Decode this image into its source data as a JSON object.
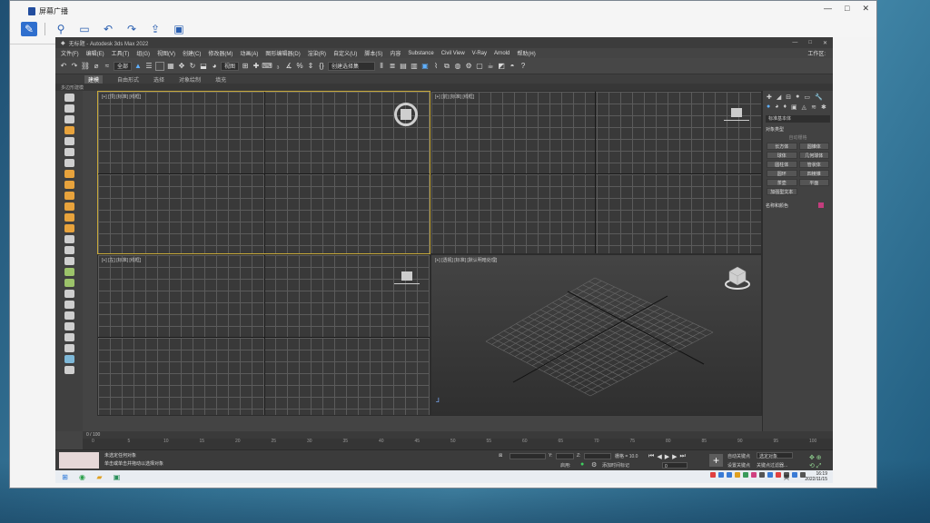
{
  "recorder": {
    "title": "屏幕广播",
    "window_controls": [
      "—",
      "□",
      "✕"
    ],
    "tools": [
      {
        "icon": "pen-icon",
        "selected": true
      },
      {
        "icon": "zoom-icon"
      },
      {
        "icon": "screen-icon"
      },
      {
        "icon": "undo-icon"
      },
      {
        "icon": "redo-icon"
      },
      {
        "icon": "upload-icon"
      },
      {
        "icon": "device-icon"
      }
    ]
  },
  "app": {
    "title": "无标题 - Autodesk 3ds Max 2022",
    "workspace_label": "工作区:",
    "menu": [
      "文件(F)",
      "编辑(E)",
      "工具(T)",
      "组(G)",
      "视图(V)",
      "创建(C)",
      "修改器(M)",
      "动画(A)",
      "图形编辑器(D)",
      "渲染(R)",
      "自定义(U)",
      "脚本(S)",
      "内容",
      "Substance",
      "Civil View",
      "V-Ray",
      "Arnold",
      "帮助(H)"
    ],
    "select_filter": "全部",
    "view_dropdown": "视图",
    "named_selection": "创建选择集",
    "ribbon_tabs": [
      "建模",
      "自由形式",
      "选择",
      "对象绘制",
      "填充"
    ],
    "active_ribbon": "建模",
    "sub_ribbon": "多边形建模",
    "viewports": {
      "top": "[+] [顶] [标准] [线框]",
      "front": "[+] [前] [标准] [线框]",
      "left": "[+] [左] [标准] [线框]",
      "persp": "[+] [透视] [标准] [默认明暗处理]"
    },
    "command_panel": {
      "category": "标准基本体",
      "section_object_type": "对象类型",
      "autogrid": "自动栅格",
      "buttons": [
        "长方体",
        "圆锥体",
        "球体",
        "几何球体",
        "圆柱体",
        "管状体",
        "圆环",
        "四棱锥",
        "茶壶",
        "平面",
        "加强型文本"
      ],
      "section_name_color": "名称和颜色"
    },
    "timeline": {
      "frame_readout": "0 / 100",
      "ticks": [
        "0",
        "5",
        "10",
        "15",
        "20",
        "25",
        "30",
        "35",
        "40",
        "45",
        "50",
        "55",
        "60",
        "65",
        "70",
        "75",
        "80",
        "85",
        "90",
        "95",
        "100"
      ]
    },
    "status": {
      "selection": "未选定任何对象",
      "prompt": "单击或单击并拖动以选择对象",
      "grid_label": "栅格 = 10.0",
      "add_time_tag": "添加时间标记",
      "x_label": "X:",
      "y_label": "Y:",
      "z_label": "Z:",
      "auto_key": "自动关键点",
      "set_key": "设置关键点",
      "selected_obj": "选定对象",
      "key_filters": "关键点过滤器...",
      "enabled_label": "启用:",
      "frame_value": "0"
    }
  },
  "taskbar": {
    "lang": "英",
    "time": "16:19",
    "date": "2022/11/15"
  },
  "colors": {
    "accent": "#2f6fce",
    "active_viewport_border": "#c8a93a",
    "object_color_swatch": "#c33d7d"
  }
}
